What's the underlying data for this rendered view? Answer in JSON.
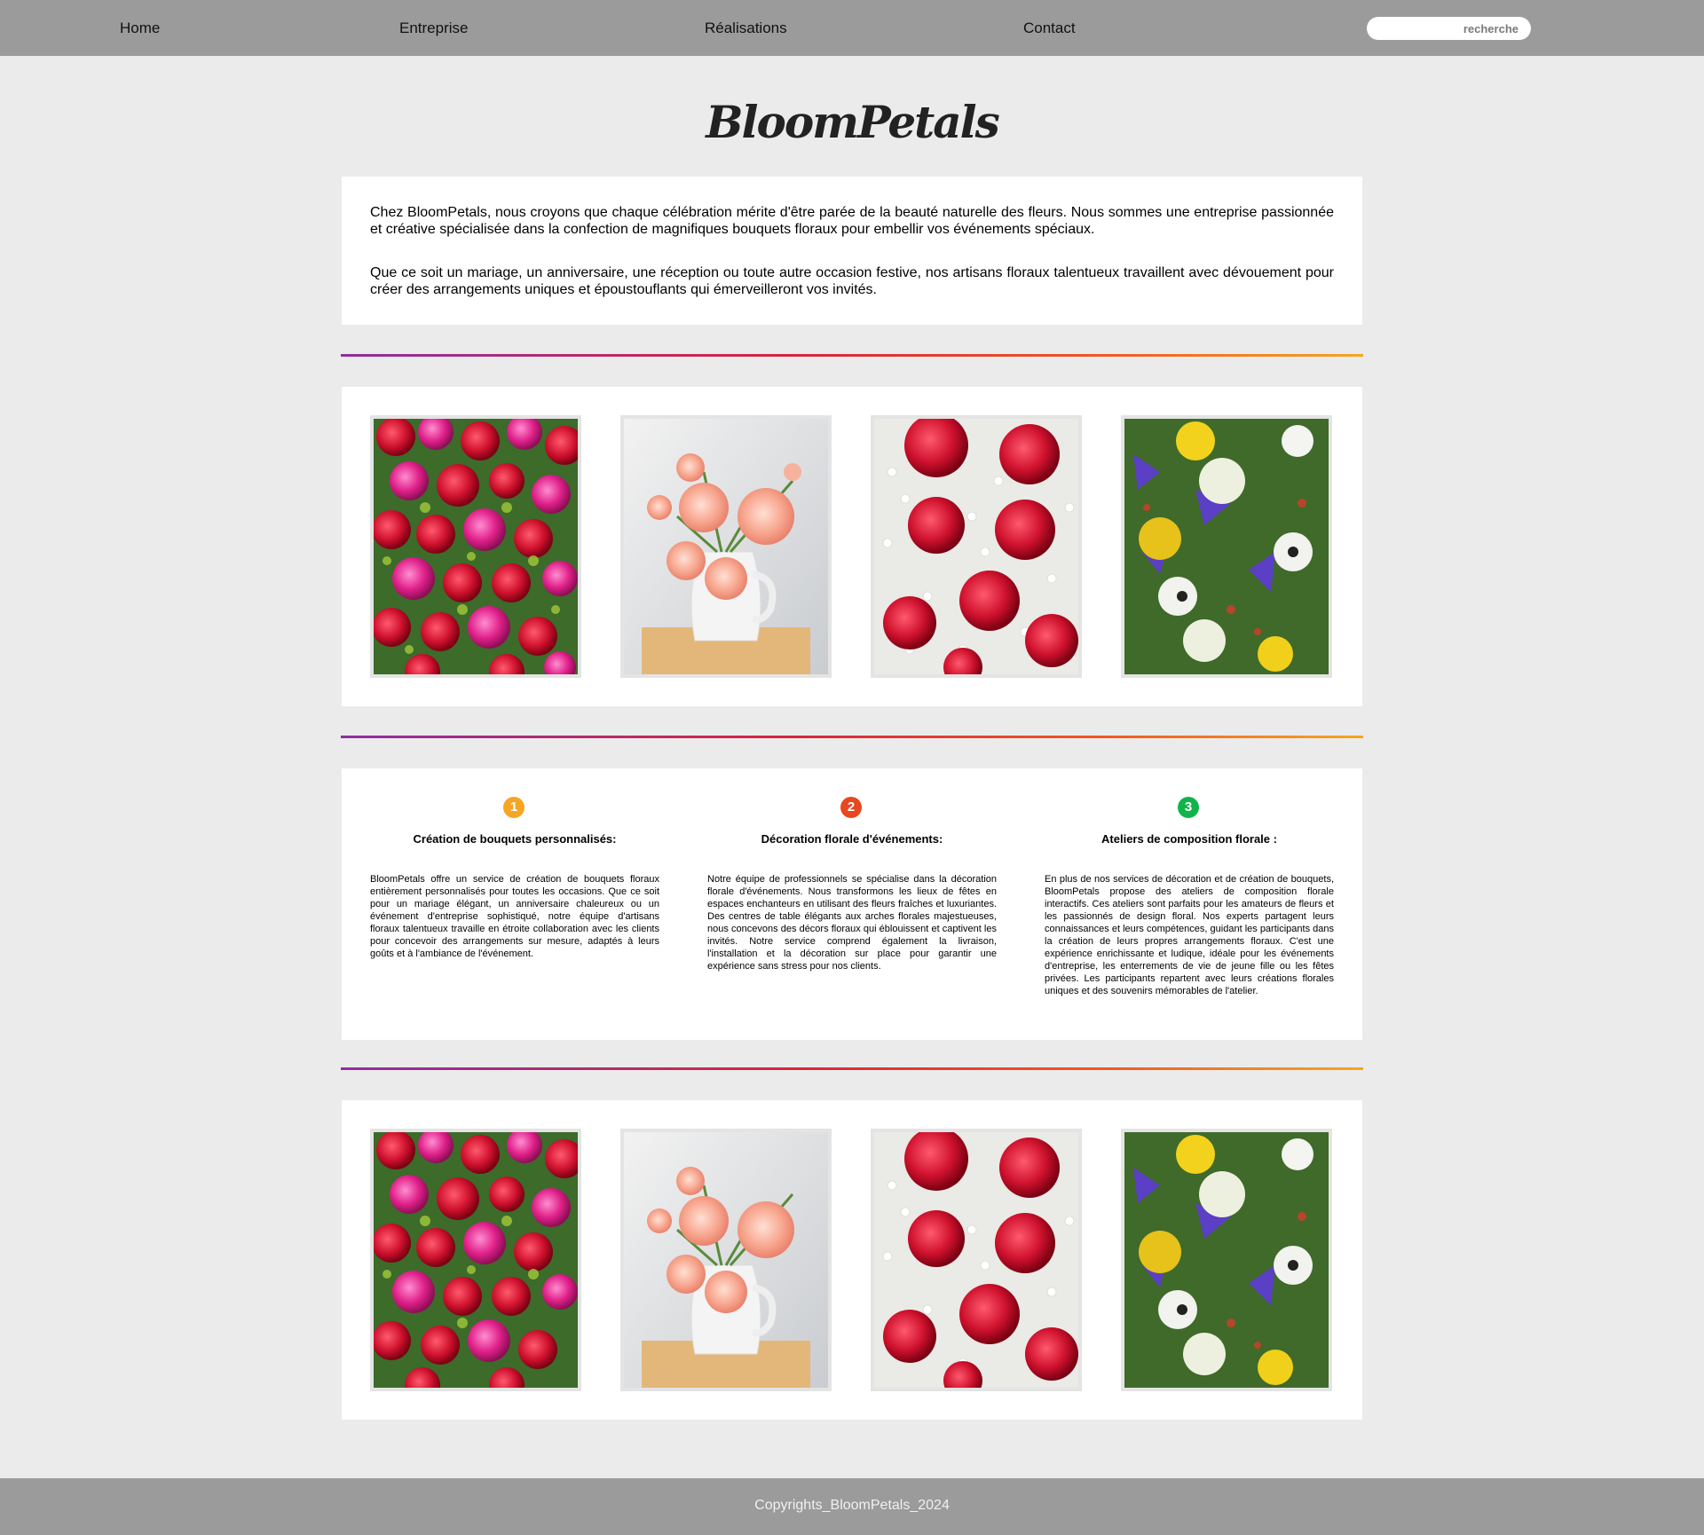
{
  "nav": {
    "items": [
      {
        "label": "Home"
      },
      {
        "label": "Entreprise"
      },
      {
        "label": "Réalisations"
      },
      {
        "label": "Contact"
      }
    ],
    "search_placeholder": "recherche"
  },
  "brand": {
    "title": "BloomPetals"
  },
  "intro": {
    "paragraphs": [
      "Chez BloomPetals, nous croyons que chaque célébration mérite d'être parée de la beauté naturelle des fleurs. Nous sommes une entreprise passionnée et créative spécialisée dans la confection de magnifiques bouquets floraux pour embellir vos événements spéciaux.",
      "Que ce soit un mariage, un anniversaire, une réception ou toute autre occasion festive, nos artisans floraux talentueux travaillent avec dévouement pour créer des arrangements uniques et époustouflants qui émerveilleront vos invités."
    ]
  },
  "gallery_top": {
    "photos": [
      {
        "subject": "red-and-pink-roses-bouquet"
      },
      {
        "subject": "pink-dahlias-in-white-pitcher"
      },
      {
        "subject": "red-roses-with-gypsophila"
      },
      {
        "subject": "mixed-wildflower-bouquet"
      }
    ]
  },
  "services": [
    {
      "number": "1",
      "color": "#f5a623",
      "title": "Création de bouquets personnalisés:",
      "text": "BloomPetals offre un service de création de bouquets floraux entièrement personnalisés pour toutes les occasions. Que ce soit pour un mariage élégant, un anniversaire chaleureux ou un événement d'entreprise sophistiqué, notre équipe d'artisans floraux talentueux travaille en étroite collaboration avec les clients pour concevoir des arrangements sur mesure, adaptés à leurs goûts et à l'ambiance de l'événement."
    },
    {
      "number": "2",
      "color": "#e8471f",
      "title": "Décoration florale d'événements:",
      "text": "Notre équipe de professionnels se spécialise dans la décoration florale d'événements. Nous transformons les lieux de fêtes en espaces enchanteurs en utilisant des fleurs fraîches et luxuriantes. Des centres de table élégants aux arches florales majestueuses, nous concevons des décors floraux qui éblouissent et captivent les invités. Notre service comprend également la livraison, l'installation et la décoration sur place pour garantir une expérience sans stress pour nos clients."
    },
    {
      "number": "3",
      "color": "#10b44a",
      "title": "Ateliers de composition florale :",
      "text": "En plus de nos services de décoration et de création de bouquets, BloomPetals propose des ateliers de composition florale interactifs. Ces ateliers sont parfaits pour les amateurs de fleurs et les passionnés de design floral. Nos experts partagent leurs connaissances et leurs compétences, guidant les participants dans la création de leurs propres arrangements floraux. C'est une expérience enrichissante et ludique, idéale pour les événements d'entreprise, les enterrements de vie de jeune fille ou les fêtes privées. Les participants repartent avec leurs créations florales uniques et des souvenirs mémorables de l'atelier."
    }
  ],
  "gallery_bottom": {
    "photos": [
      {
        "subject": "red-and-pink-roses-bouquet"
      },
      {
        "subject": "pink-dahlias-in-white-pitcher"
      },
      {
        "subject": "red-roses-with-gypsophila"
      },
      {
        "subject": "mixed-wildflower-bouquet"
      }
    ]
  },
  "footer": {
    "copyright": "Copyrights_BloomPetals_2024"
  }
}
